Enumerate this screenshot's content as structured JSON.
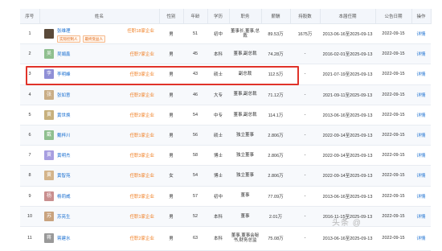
{
  "columns": [
    "序号",
    "姓名",
    "性别",
    "年龄",
    "学历",
    "职务",
    "薪酬",
    "持股数",
    "本届任期",
    "公告日期",
    "操作"
  ],
  "rows": [
    {
      "no": "1",
      "avatar": "",
      "name": "张维理",
      "role": "任职18家企业",
      "tags": [
        "实际控制人",
        "最终受益人"
      ],
      "gender": "男",
      "age": "51",
      "edu": "初中",
      "title": "董事长,董事,总裁",
      "salary": "89.53万",
      "shares": "1675万",
      "term": "2013-06-16至2025-09-13",
      "date": "2022-09-15",
      "action": "详情"
    },
    {
      "no": "2",
      "avatar": "吴",
      "name": "吴娟鑫",
      "role": "任职7家企业",
      "tags": [],
      "gender": "男",
      "age": "45",
      "edu": "本科",
      "title": "董事,副总裁",
      "salary": "74.28万",
      "shares": "-",
      "term": "2016-02-01至2025-09-13",
      "date": "2022-09-15",
      "action": "详情"
    },
    {
      "no": "3",
      "avatar": "李",
      "name": "李明峰",
      "role": "任职3家企业",
      "tags": [],
      "gender": "男",
      "age": "43",
      "edu": "硕士",
      "title": "副总裁",
      "salary": "112.5万",
      "shares": "-",
      "term": "2021-07-19至2025-09-13",
      "date": "2022-09-15",
      "action": "详情"
    },
    {
      "no": "4",
      "avatar": "张",
      "name": "张如意",
      "role": "任职2家企业",
      "tags": [],
      "gender": "男",
      "age": "46",
      "edu": "大专",
      "title": "董事,副总裁",
      "salary": "71.12万",
      "shares": "-",
      "term": "2021-09-11至2025-09-13",
      "date": "2022-09-15",
      "action": "详情"
    },
    {
      "no": "5",
      "avatar": "黄",
      "name": "黄世焕",
      "role": "任职2家企业",
      "tags": [],
      "gender": "男",
      "age": "54",
      "edu": "中专",
      "title": "董事,副总裁",
      "salary": "114.1万",
      "shares": "-",
      "term": "2013-06-16至2025-09-13",
      "date": "2022-09-15",
      "action": "详情"
    },
    {
      "no": "6",
      "avatar": "戴",
      "name": "戴梓川",
      "role": "任职1家企业",
      "tags": [],
      "gender": "男",
      "age": "56",
      "edu": "硕士",
      "title": "独立董事",
      "salary": "2.806万",
      "shares": "-",
      "term": "2022-09-14至2025-09-13",
      "date": "2022-09-15",
      "action": "详情"
    },
    {
      "no": "7",
      "avatar": "黄",
      "name": "黄明杰",
      "role": "任职3家企业",
      "tags": [],
      "gender": "男",
      "age": "58",
      "edu": "博士",
      "title": "独立董事",
      "salary": "2.806万",
      "shares": "-",
      "term": "2022-09-14至2025-09-13",
      "date": "2022-09-15",
      "action": "详情"
    },
    {
      "no": "8",
      "avatar": "黄",
      "name": "黄智苑",
      "role": "任职5家企业",
      "tags": [],
      "gender": "女",
      "age": "54",
      "edu": "博士",
      "title": "独立董事",
      "salary": "2.806万",
      "shares": "-",
      "term": "2022-09-14至2025-09-13",
      "date": "2022-09-15",
      "action": "详情"
    },
    {
      "no": "9",
      "avatar": "杨",
      "name": "杨莉威",
      "role": "任职2家企业",
      "tags": [],
      "gender": "男",
      "age": "57",
      "edu": "初中",
      "title": "董事",
      "salary": "77.09万",
      "shares": "-",
      "term": "2013-06-16至2025-09-13",
      "date": "2022-09-15",
      "action": "详情"
    },
    {
      "no": "10",
      "avatar": "苏",
      "name": "苏亮生",
      "role": "任职1家企业",
      "tags": [],
      "gender": "男",
      "age": "52",
      "edu": "本科",
      "title": "董事",
      "salary": "2.01万",
      "shares": "-",
      "term": "2016-11-15至2025-09-13",
      "date": "2022-09-15",
      "action": "详情"
    },
    {
      "no": "11",
      "avatar": "蒋",
      "name": "蒋建水",
      "role": "任职2家企业",
      "tags": [],
      "gender": "男",
      "age": "63",
      "edu": "本科",
      "title": "董事,董事会秘书,财务总监",
      "salary": "75.08万",
      "shares": "-",
      "term": "2013-06-16至2025-09-13",
      "date": "2022-09-15",
      "action": "详情"
    }
  ],
  "avatar_colors": [
    "#5a4a3a",
    "#8fbf8f",
    "#8f8fd6",
    "#c9ad86",
    "#c7b07d",
    "#8fbf8f",
    "#a79ee0",
    "#d4b48a",
    "#c98f8f",
    "#c9a37e",
    "#999999"
  ],
  "watermark": "头条 @"
}
